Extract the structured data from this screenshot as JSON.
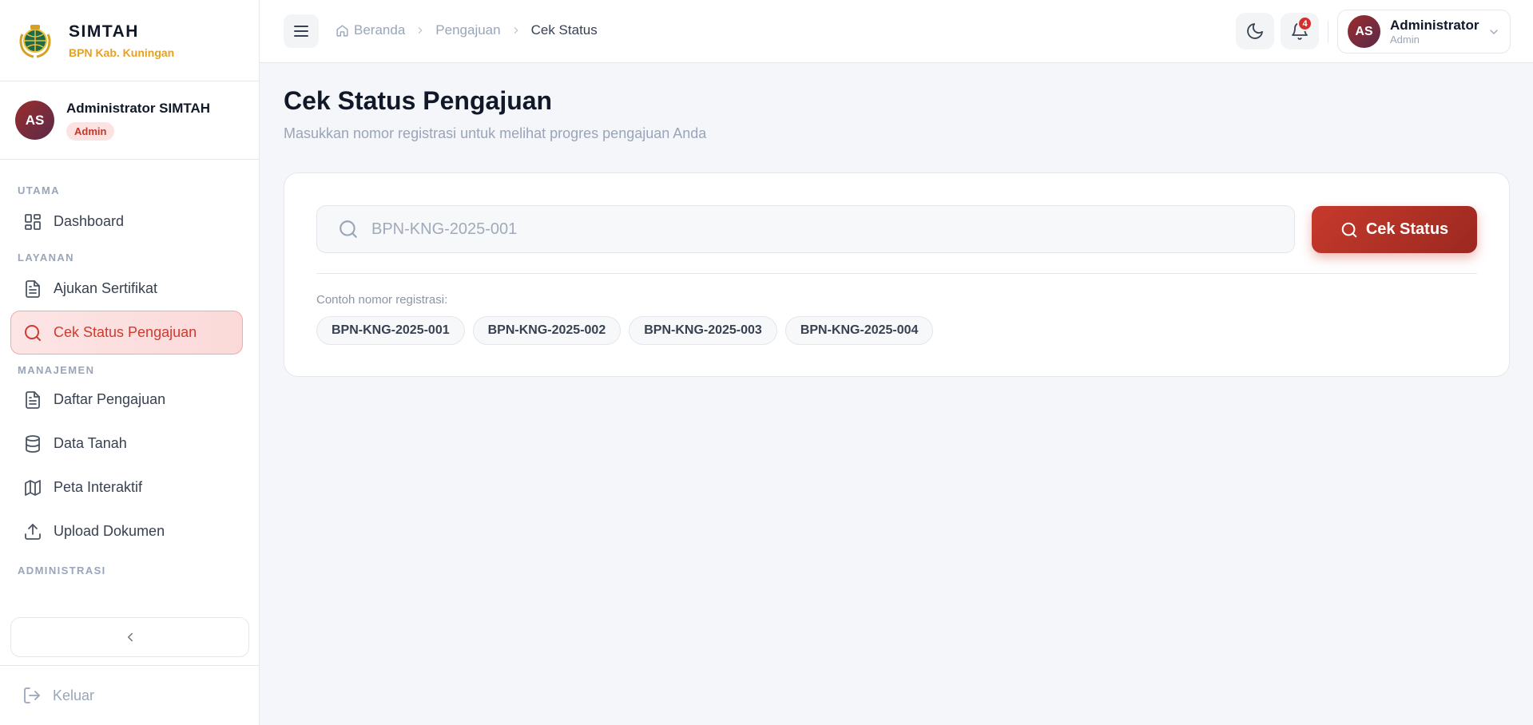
{
  "brand": {
    "title": "SIMTAH",
    "subtitle": "BPN Kab. Kuningan"
  },
  "user": {
    "initials": "AS",
    "name": "Administrator SIMTAH",
    "role": "Admin"
  },
  "sidebar": {
    "sections": [
      {
        "label": "UTAMA"
      },
      {
        "label": "LAYANAN"
      },
      {
        "label": "MANAJEMEN"
      },
      {
        "label": "ADMINISTRASI"
      }
    ],
    "items": [
      {
        "label": "Dashboard",
        "icon": "grid-icon"
      },
      {
        "label": "Ajukan Sertifikat",
        "icon": "document-icon"
      },
      {
        "label": "Cek Status Pengajuan",
        "icon": "search-icon",
        "active": true
      },
      {
        "label": "Daftar Pengajuan",
        "icon": "document-icon"
      },
      {
        "label": "Data Tanah",
        "icon": "database-icon"
      },
      {
        "label": "Peta Interaktif",
        "icon": "map-icon"
      },
      {
        "label": "Upload Dokumen",
        "icon": "upload-icon"
      }
    ],
    "logout": "Keluar"
  },
  "header": {
    "breadcrumb": [
      "Beranda",
      "Pengajuan",
      "Cek Status"
    ],
    "notification_count": "4",
    "profile": {
      "initials": "AS",
      "name": "Administrator",
      "role": "Admin"
    }
  },
  "main": {
    "title": "Cek Status Pengajuan",
    "subtitle": "Masukkan nomor registrasi untuk melihat progres pengajuan Anda",
    "search": {
      "placeholder": "BPN-KNG-2025-001",
      "value": ""
    },
    "button_label": "Cek Status",
    "examples_label": "Contoh nomor registrasi:",
    "examples": [
      "BPN-KNG-2025-001",
      "BPN-KNG-2025-002",
      "BPN-KNG-2025-003",
      "BPN-KNG-2025-004"
    ]
  },
  "colors": {
    "accent": "#c73a2c",
    "brand_subtitle": "#e8a023",
    "active_bg": "#fde5e5",
    "muted": "#9aa5b8"
  }
}
